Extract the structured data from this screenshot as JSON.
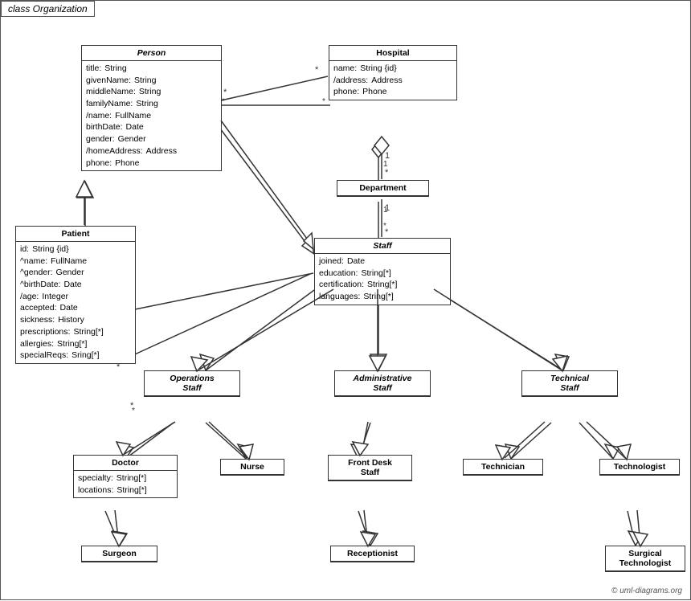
{
  "diagram": {
    "title": "class Organization",
    "copyright": "© uml-diagrams.org",
    "classes": {
      "person": {
        "name": "Person",
        "italic": true,
        "attrs": [
          [
            "title:",
            "String"
          ],
          [
            "givenName:",
            "String"
          ],
          [
            "middleName:",
            "String"
          ],
          [
            "familyName:",
            "String"
          ],
          [
            "/name:",
            "FullName"
          ],
          [
            "birthDate:",
            "Date"
          ],
          [
            "gender:",
            "Gender"
          ],
          [
            "/homeAddress:",
            "Address"
          ],
          [
            "phone:",
            "Phone"
          ]
        ]
      },
      "hospital": {
        "name": "Hospital",
        "italic": false,
        "attrs": [
          [
            "name:",
            "String {id}"
          ],
          [
            "/address:",
            "Address"
          ],
          [
            "phone:",
            "Phone"
          ]
        ]
      },
      "department": {
        "name": "Department",
        "italic": false,
        "attrs": []
      },
      "staff": {
        "name": "Staff",
        "italic": true,
        "attrs": [
          [
            "joined:",
            "Date"
          ],
          [
            "education:",
            "String[*]"
          ],
          [
            "certification:",
            "String[*]"
          ],
          [
            "languages:",
            "String[*]"
          ]
        ]
      },
      "patient": {
        "name": "Patient",
        "italic": false,
        "attrs": [
          [
            "id:",
            "String {id}"
          ],
          [
            "^name:",
            "FullName"
          ],
          [
            "^gender:",
            "Gender"
          ],
          [
            "^birthDate:",
            "Date"
          ],
          [
            "/age:",
            "Integer"
          ],
          [
            "accepted:",
            "Date"
          ],
          [
            "sickness:",
            "History"
          ],
          [
            "prescriptions:",
            "String[*]"
          ],
          [
            "allergies:",
            "String[*]"
          ],
          [
            "specialReqs:",
            "Sring[*]"
          ]
        ]
      },
      "operationsStaff": {
        "name": "Operations Staff",
        "italic": true,
        "attrs": []
      },
      "administrativeStaff": {
        "name": "Administrative Staff",
        "italic": true,
        "attrs": []
      },
      "technicalStaff": {
        "name": "Technical Staff",
        "italic": true,
        "attrs": []
      },
      "doctor": {
        "name": "Doctor",
        "italic": false,
        "attrs": [
          [
            "specialty:",
            "String[*]"
          ],
          [
            "locations:",
            "String[*]"
          ]
        ]
      },
      "nurse": {
        "name": "Nurse",
        "italic": false,
        "attrs": []
      },
      "frontDeskStaff": {
        "name": "Front Desk Staff",
        "italic": false,
        "attrs": []
      },
      "technician": {
        "name": "Technician",
        "italic": false,
        "attrs": []
      },
      "technologist": {
        "name": "Technologist",
        "italic": false,
        "attrs": []
      },
      "surgeon": {
        "name": "Surgeon",
        "italic": false,
        "attrs": []
      },
      "receptionist": {
        "name": "Receptionist",
        "italic": false,
        "attrs": []
      },
      "surgicalTechnologist": {
        "name": "Surgical Technologist",
        "italic": false,
        "attrs": []
      }
    }
  }
}
